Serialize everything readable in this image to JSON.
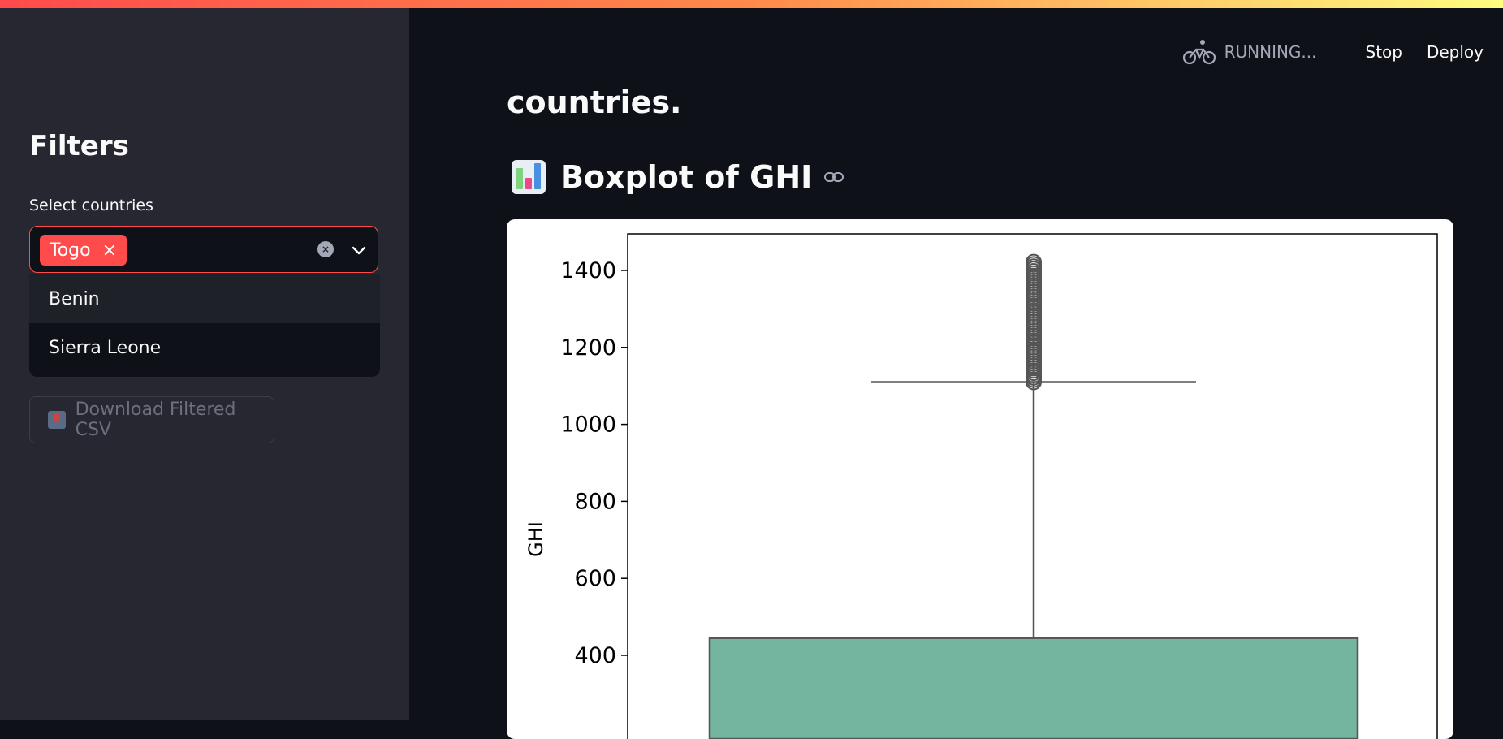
{
  "sidebar": {
    "title": "Filters",
    "select_label": "Select countries",
    "selected_tags": [
      "Togo"
    ],
    "tag_remove_glyph": "×",
    "clear_glyph": "×",
    "options": [
      "Benin",
      "Sierra Leone"
    ],
    "download_label": "Download Filtered CSV"
  },
  "toolbar": {
    "status": "RUNNING...",
    "stop_label": "Stop",
    "deploy_label": "Deploy"
  },
  "main": {
    "heading_fragment": "countries.",
    "section_title": "Boxplot of GHI"
  },
  "colors": {
    "accent": "#ff4b4b",
    "sidebar_bg": "#262730",
    "main_bg": "#0e1117",
    "box_fill": "#74b59f"
  },
  "chart_data": {
    "type": "box",
    "ylabel": "GHI",
    "yticks": [
      400,
      600,
      800,
      1000,
      1200,
      1400
    ],
    "ylim": [
      250,
      1490
    ],
    "box_top_q3": 445,
    "upper_whisker": 1110,
    "outliers_range": [
      1110,
      1425
    ]
  }
}
